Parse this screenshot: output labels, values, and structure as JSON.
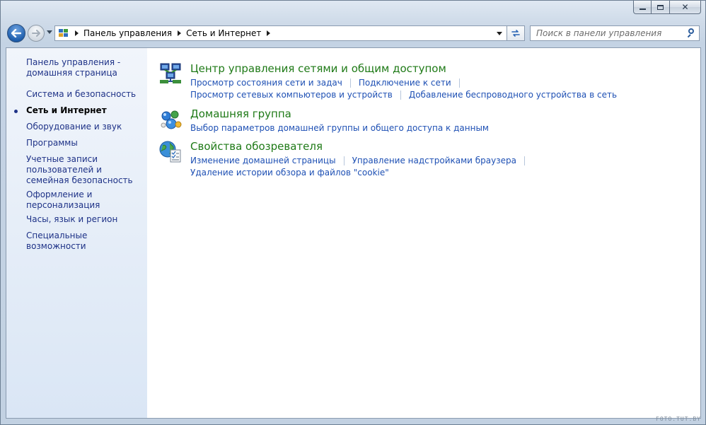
{
  "window": {
    "caption": {
      "minimize_glyph": "",
      "close_glyph": "✕"
    }
  },
  "address_bar": {
    "crumbs": [
      "Панель управления",
      "Сеть и Интернет"
    ]
  },
  "search": {
    "placeholder": "Поиск в панели управления"
  },
  "sidebar": {
    "items": [
      {
        "label": "Панель управления - домашняя страница",
        "active": false
      },
      {
        "label": "Система и безопасность",
        "active": false
      },
      {
        "label": "Сеть и Интернет",
        "active": true
      },
      {
        "label": "Оборудование и звук",
        "active": false
      },
      {
        "label": "Программы",
        "active": false
      },
      {
        "label": "Учетные записи пользователей и семейная безопасность",
        "active": false
      },
      {
        "label": "Оформление и персонализация",
        "active": false
      },
      {
        "label": "Часы, язык и регион",
        "active": false
      },
      {
        "label": "Специальные возможности",
        "active": false
      }
    ]
  },
  "categories": [
    {
      "icon": "network-center-icon",
      "title": "Центр управления сетями и общим доступом",
      "rows": [
        [
          "Просмотр состояния сети и задач",
          "Подключение к сети"
        ],
        [
          "Просмотр сетевых компьютеров и устройств",
          "Добавление беспроводного устройства в сеть"
        ]
      ]
    },
    {
      "icon": "homegroup-icon",
      "title": "Домашняя группа",
      "rows": [
        [
          "Выбор параметров домашней группы и общего доступа к данным"
        ]
      ]
    },
    {
      "icon": "internet-options-icon",
      "title": "Свойства обозревателя",
      "rows": [
        [
          "Изменение домашней страницы",
          "Управление надстройками браузера"
        ],
        [
          "Удаление истории обзора и файлов \"cookie\""
        ]
      ]
    }
  ],
  "watermark": "FOTO.TUT.BY",
  "colors": {
    "category_title": "#1f7a17",
    "link": "#1e50b4",
    "sidebar_link": "#1e3287"
  }
}
